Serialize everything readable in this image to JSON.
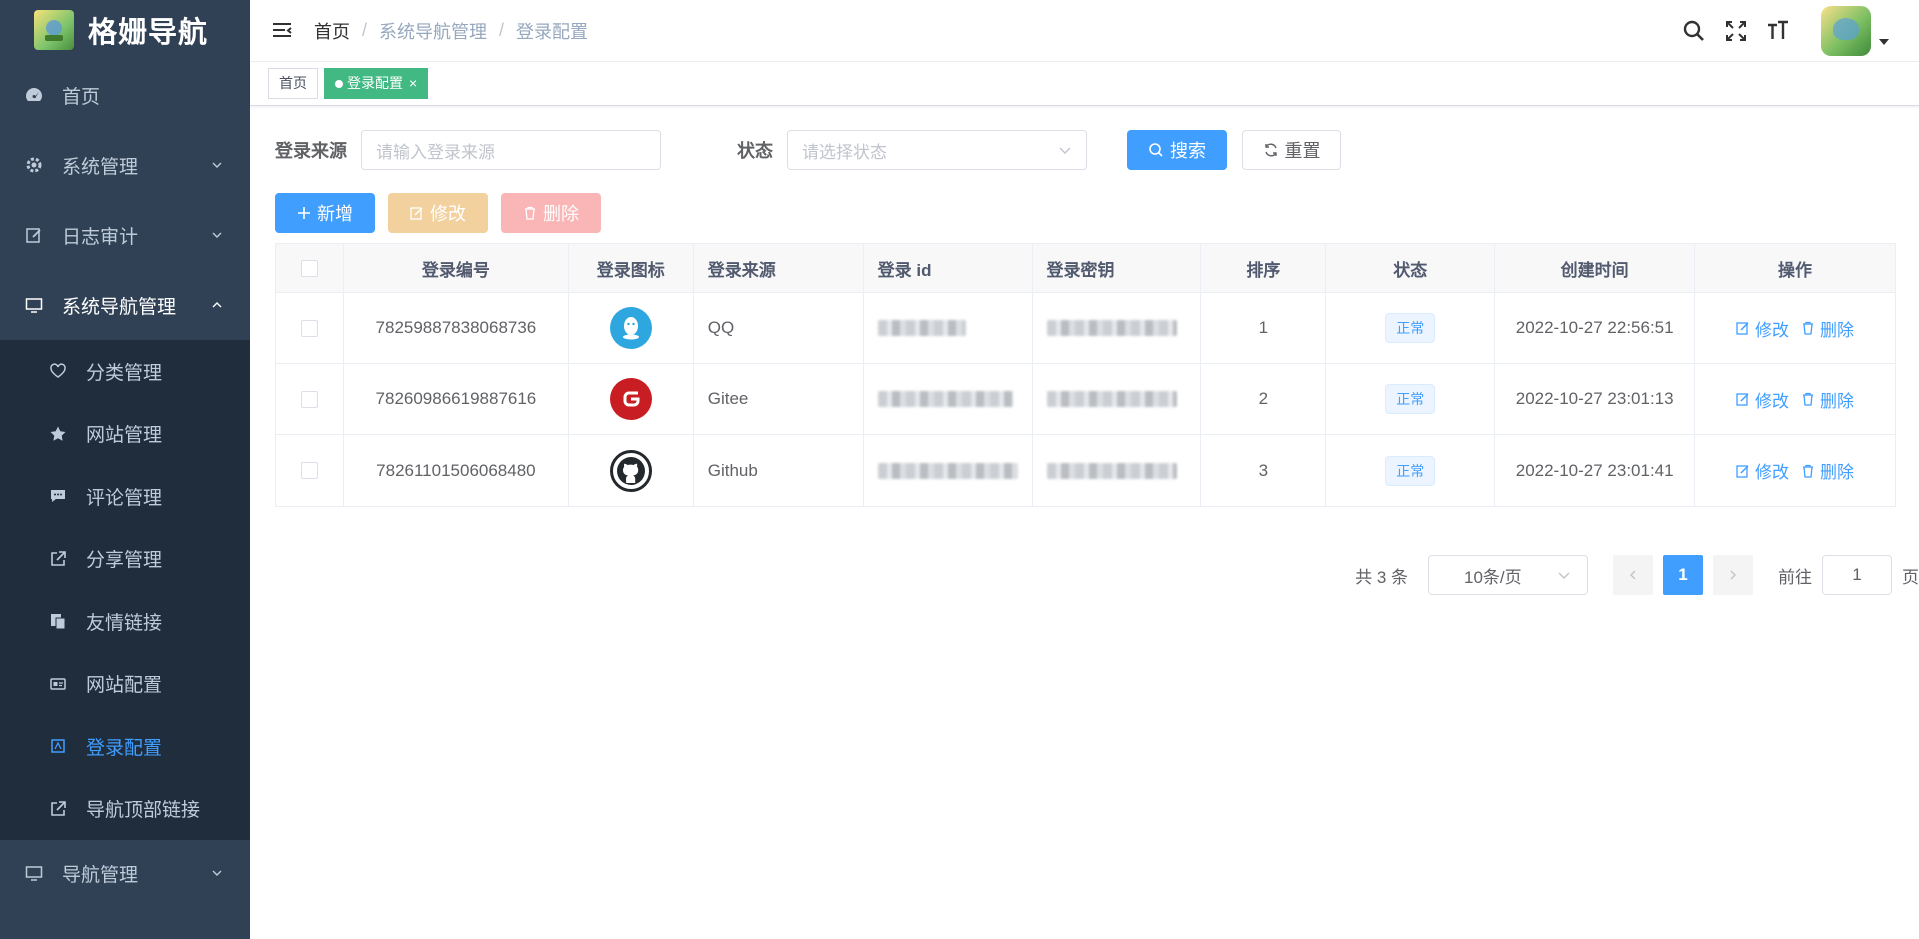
{
  "app": {
    "title": "格姗导航"
  },
  "sidebar": {
    "items": [
      {
        "label": "首页",
        "icon": "dashboard-icon"
      },
      {
        "label": "系统管理",
        "icon": "gear-icon"
      },
      {
        "label": "日志审计",
        "icon": "edit-icon"
      },
      {
        "label": "系统导航管理",
        "icon": "monitor-icon"
      },
      {
        "label": "导航管理",
        "icon": "monitor-icon"
      }
    ],
    "subitems": [
      {
        "label": "分类管理",
        "icon": "heart-icon"
      },
      {
        "label": "网站管理",
        "icon": "star-icon"
      },
      {
        "label": "评论管理",
        "icon": "comment-icon"
      },
      {
        "label": "分享管理",
        "icon": "external-link-icon"
      },
      {
        "label": "友情链接",
        "icon": "copy-icon"
      },
      {
        "label": "网站配置",
        "icon": "id-card-icon"
      },
      {
        "label": "登录配置",
        "icon": "login-icon"
      },
      {
        "label": "导航顶部链接",
        "icon": "external-link-icon"
      }
    ],
    "active_color": "#409eff"
  },
  "header": {
    "breadcrumb": [
      "首页",
      "系统导航管理",
      "登录配置"
    ],
    "separator": "/"
  },
  "tags": {
    "home": "首页",
    "current": "登录配置",
    "close": "×",
    "active_color": "#42b983"
  },
  "search": {
    "source_label": "登录来源",
    "source_placeholder": "请输入登录来源",
    "status_label": "状态",
    "status_placeholder": "请选择状态",
    "search_button": "搜索",
    "reset_button": "重置"
  },
  "actions": {
    "add": "新增",
    "edit": "修改",
    "delete": "删除"
  },
  "table": {
    "headers": [
      "登录编号",
      "登录图标",
      "登录来源",
      "登录 id",
      "登录密钥",
      "排序",
      "状态",
      "创建时间",
      "操作"
    ],
    "rows": [
      {
        "id": "78259887838068736",
        "icon": "qq-icon",
        "source": "QQ",
        "sort": "1",
        "status": "正常",
        "created": "2022-10-27 22:56:51"
      },
      {
        "id": "78260986619887616",
        "icon": "gitee-icon",
        "source": "Gitee",
        "sort": "2",
        "status": "正常",
        "created": "2022-10-27 23:01:13"
      },
      {
        "id": "78261101506068480",
        "icon": "github-icon",
        "source": "Github",
        "sort": "3",
        "status": "正常",
        "created": "2022-10-27 23:01:41"
      }
    ],
    "op_edit": "修改",
    "op_delete": "删除"
  },
  "pagination": {
    "total": "共 3 条",
    "page_size": "10条/页",
    "current_page": "1",
    "goto_label": "前往",
    "goto_value": "1",
    "goto_suffix": "页"
  }
}
